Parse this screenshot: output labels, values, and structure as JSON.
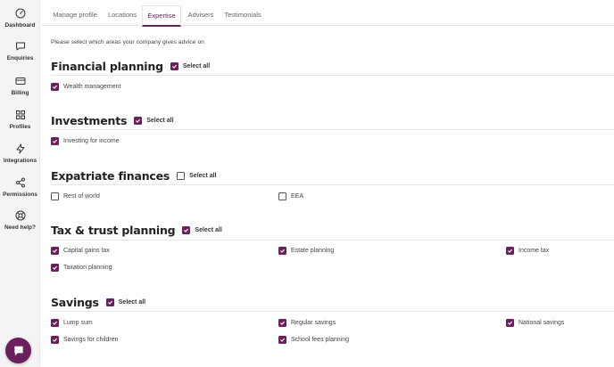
{
  "sidebar": {
    "items": [
      {
        "label": "Dashboard",
        "icon": "dashboard-gauge-icon"
      },
      {
        "label": "Enquiries",
        "icon": "speech-bubble-icon"
      },
      {
        "label": "Billing",
        "icon": "credit-card-icon"
      },
      {
        "label": "Profiles",
        "icon": "grid-icon"
      },
      {
        "label": "Integrations",
        "icon": "lightning-icon"
      },
      {
        "label": "Permissions",
        "icon": "share-nodes-icon"
      },
      {
        "label": "Need help?",
        "icon": "lifebuoy-icon"
      }
    ]
  },
  "tabs": [
    {
      "label": "Manage profile",
      "active": false
    },
    {
      "label": "Locations",
      "active": false
    },
    {
      "label": "Expertise",
      "active": true
    },
    {
      "label": "Advisers",
      "active": false
    },
    {
      "label": "Testimonials",
      "active": false
    }
  ],
  "intro": "Please select which areas your company gives advice on",
  "select_all_label": "Select all",
  "accent_color": "#6b1f5c",
  "sections": [
    {
      "title": "Financial planning",
      "select_all_checked": true,
      "options": [
        {
          "label": "Wealth management",
          "checked": true
        }
      ]
    },
    {
      "title": "Investments",
      "select_all_checked": true,
      "options": [
        {
          "label": "Investing for income",
          "checked": true
        }
      ]
    },
    {
      "title": "Expatriate finances",
      "select_all_checked": false,
      "options": [
        {
          "label": "Rest of world",
          "checked": false
        },
        {
          "label": "EEA",
          "checked": false
        }
      ]
    },
    {
      "title": "Tax & trust planning",
      "select_all_checked": true,
      "options": [
        {
          "label": "Capital gains tax",
          "checked": true
        },
        {
          "label": "Estate planning",
          "checked": true
        },
        {
          "label": "Income tax",
          "checked": true
        },
        {
          "label": "Taxation planning",
          "checked": true
        }
      ]
    },
    {
      "title": "Savings",
      "select_all_checked": true,
      "options": [
        {
          "label": "Lump sum",
          "checked": true
        },
        {
          "label": "Regular savings",
          "checked": true
        },
        {
          "label": "National savings",
          "checked": true
        },
        {
          "label": "Savings for children",
          "checked": true
        },
        {
          "label": "School fees planning",
          "checked": true
        }
      ]
    }
  ],
  "chat_icon": "chat-bubble-icon"
}
